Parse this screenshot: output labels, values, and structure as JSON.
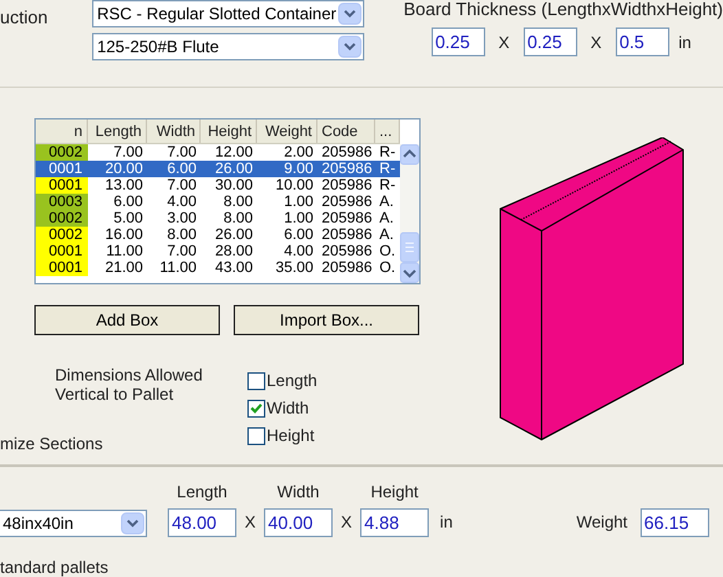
{
  "top": {
    "construction_label": "uction",
    "style_select": "RSC - Regular Slotted Container",
    "flute_select": "125-250#B Flute",
    "board_thickness_label": "Board Thickness (LengthxWidthxHeight)",
    "thickness": [
      "0.25",
      "0.25",
      "0.5"
    ],
    "separators": [
      "X",
      "X"
    ],
    "unit": "in"
  },
  "grid": {
    "columns": [
      "n",
      "Length",
      "Width",
      "Height",
      "Weight",
      "Code",
      "..."
    ],
    "rows": [
      {
        "cells": [
          "0002",
          "7.00",
          "7.00",
          "12.00",
          "2.00",
          "205986",
          "R-"
        ],
        "color": "#99c31f",
        "selected": false
      },
      {
        "cells": [
          "0001",
          "20.00",
          "6.00",
          "26.00",
          "9.00",
          "205986",
          "R-"
        ],
        "selected": true
      },
      {
        "cells": [
          "0001",
          "13.00",
          "7.00",
          "30.00",
          "10.00",
          "205986",
          "R-"
        ],
        "color": "#ffff00",
        "selected": false
      },
      {
        "cells": [
          "0003",
          "6.00",
          "4.00",
          "8.00",
          "1.00",
          "205986",
          "A."
        ],
        "color": "#99c31f",
        "selected": false
      },
      {
        "cells": [
          "0002",
          "5.00",
          "3.00",
          "8.00",
          "1.00",
          "205986",
          "A."
        ],
        "color": "#99c31f",
        "selected": false
      },
      {
        "cells": [
          "0002",
          "16.00",
          "8.00",
          "26.00",
          "6.00",
          "205986",
          "A."
        ],
        "color": "#ffff00",
        "selected": false
      },
      {
        "cells": [
          "0001",
          "11.00",
          "7.00",
          "28.00",
          "4.00",
          "205986",
          "O."
        ],
        "color": "#ffff00",
        "selected": false
      },
      {
        "cells": [
          "0001",
          "21.00",
          "11.00",
          "43.00",
          "35.00",
          "205986",
          "O."
        ],
        "color": "#ffff00",
        "selected": false
      }
    ]
  },
  "buttons": [
    "Add Box",
    "Import Box..."
  ],
  "vertical": {
    "label": "Dimensions Allowed\nVertical to Pallet",
    "options": [
      {
        "label": "Length",
        "checked": false
      },
      {
        "label": "Width",
        "checked": true
      },
      {
        "label": "Height",
        "checked": false
      }
    ]
  },
  "optimize_label": "mize Sections",
  "pallet": {
    "select": "48inx40in",
    "fields": [
      {
        "label": "Length",
        "value": "48.00"
      },
      {
        "label": "Width",
        "value": "40.00"
      },
      {
        "label": "Height",
        "value": "4.88"
      }
    ],
    "separators": [
      "X",
      "X"
    ],
    "unit": "in",
    "weight_label": "Weight",
    "weight": "66.15"
  },
  "footer_label": "tandard pallets"
}
